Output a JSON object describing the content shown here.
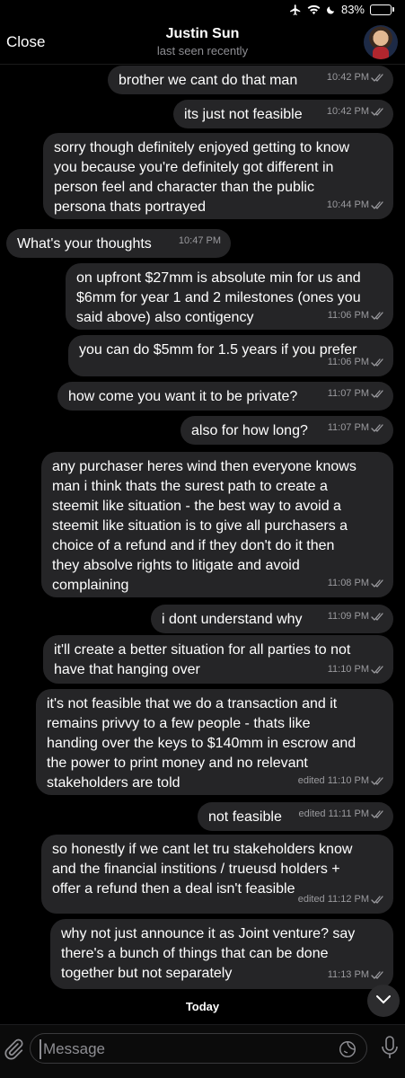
{
  "status_bar": {
    "battery": "83%",
    "battery_level": 0.83
  },
  "header": {
    "back_label": "Close",
    "title": "Justin Sun",
    "subtitle": "last seen recently"
  },
  "messages": [
    {
      "dir": "out",
      "text": "brother we cant do that man",
      "time": "10:42 PM"
    },
    {
      "dir": "out",
      "text": "its just not feasible",
      "time": "10:42 PM"
    },
    {
      "dir": "out",
      "text": "sorry though definitely enjoyed getting to know\nyou because you're definitely got different in\nperson feel and character than the public\npersona thats portrayed",
      "time": "10:44 PM"
    },
    {
      "dir": "in",
      "text": "What's your thoughts",
      "time": "10:47 PM"
    },
    {
      "dir": "out",
      "text": "on upfront $27mm is absolute min for us and\n$6mm for year 1 and 2 milestones (ones you\nsaid above) also contigency",
      "time": "11:06 PM"
    },
    {
      "dir": "out",
      "text": "you can do $5mm for 1.5 years if you prefer",
      "time": "11:06 PM"
    },
    {
      "dir": "out",
      "text": "how come you want it to be private?",
      "time": "11:07 PM"
    },
    {
      "dir": "out",
      "text": "also for how long?",
      "time": "11:07 PM"
    },
    {
      "dir": "out",
      "text": "any purchaser heres wind then everyone knows\nman  i think thats the surest path to create a\nsteemit like situation - the best way to avoid a\nsteemit like situation is to give all purchasers a\nchoice of a refund and if they don't do it then\nthey absolve rights to litigate and avoid\ncomplaining",
      "time": "11:08 PM"
    },
    {
      "dir": "out",
      "text": "i dont understand why",
      "time": "11:09 PM"
    },
    {
      "dir": "out",
      "text": "it'll create a better situation for all parties to not\nhave that hanging over",
      "time": "11:10 PM"
    },
    {
      "dir": "out",
      "text": "it's not feasible that we do a transaction and it\nremains privvy to a few people - thats like\nhanding over the keys to $140mm in escrow and\nthe power to print money and no relevant\nstakeholders are told",
      "time": "edited 11:10 PM"
    },
    {
      "dir": "out",
      "text": "not feasible",
      "time": "edited 11:11 PM"
    },
    {
      "dir": "out",
      "text": "so honestly if we cant let tru stakeholders know\nand the financial institions / trueusd holders +\noffer a refund then a deal isn't feasible",
      "time": "edited 11:12 PM"
    },
    {
      "dir": "out",
      "text": "why not just announce it as Joint venture? say\nthere's a bunch of things that can be done\ntogether but not separately",
      "time": "11:13 PM"
    }
  ],
  "date_separator": "Today",
  "composer": {
    "placeholder": "Message"
  },
  "icons": [
    "airplane-icon",
    "wifi-icon",
    "moon-icon",
    "battery-icon",
    "attach-icon",
    "sticker-icon",
    "mic-icon",
    "chevron-down-icon",
    "double-check-icon"
  ]
}
